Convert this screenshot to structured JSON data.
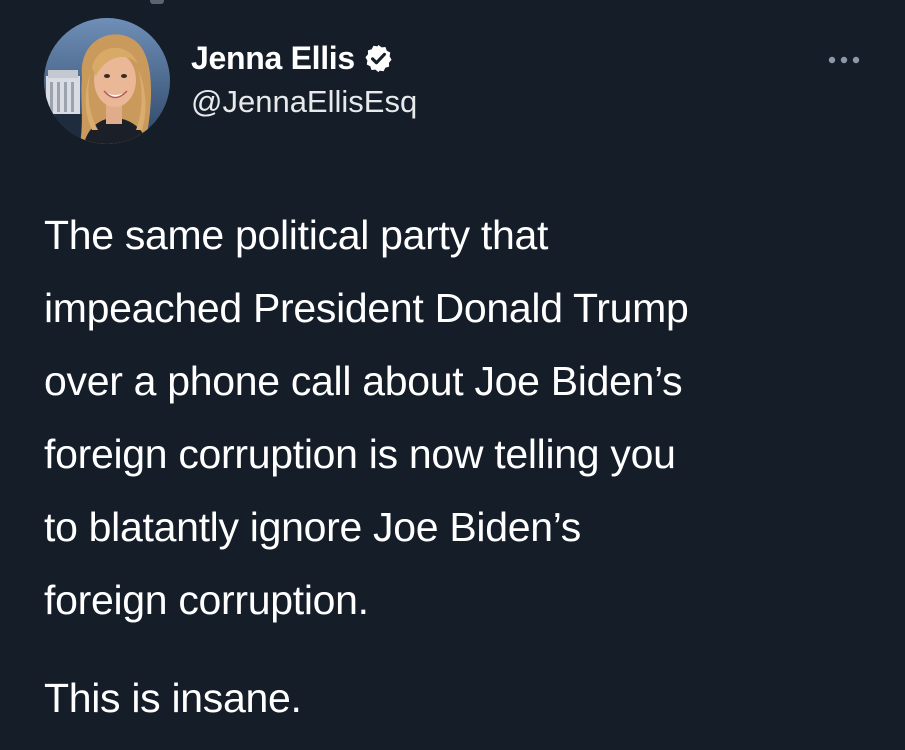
{
  "tweet": {
    "author": {
      "display_name": "Jenna Ellis",
      "handle": "@JennaEllisEsq",
      "verified": true,
      "avatar_icon": "profile-photo"
    },
    "more_icon": "more-horizontal-icon",
    "body_lines": [
      "The same political party that",
      "impeached President Donald Trump",
      "over a phone call about Joe Biden’s",
      "foreign corruption is now telling you",
      "to blatantly ignore Joe Biden’s",
      "foreign corruption."
    ],
    "body_paragraph_2": "This is insane."
  },
  "colors": {
    "background": "#151d29",
    "text": "#ffffff",
    "verified_badge": "#ffffff"
  }
}
